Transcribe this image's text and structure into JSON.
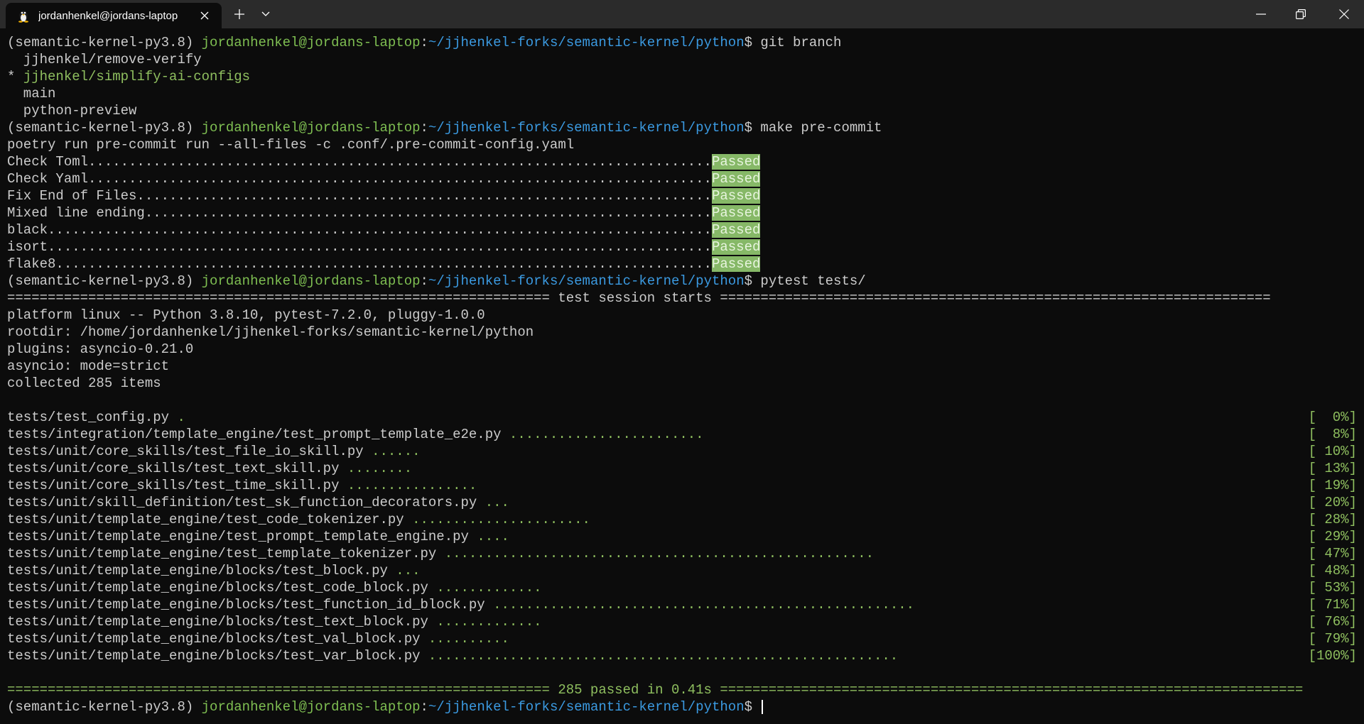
{
  "window": {
    "tab_title": "jordanhenkel@jordans-laptop",
    "tab_icon": "linux-penguin-icon",
    "new_tab_icon": "plus-icon",
    "dropdown_icon": "chevron-down-icon",
    "minimize_icon": "minimize-icon",
    "restore_icon": "restore-icon",
    "close_icon": "close-icon"
  },
  "colors": {
    "background": "#0c0c0c",
    "text": "#cccccc",
    "user": "#7fbf52",
    "path": "#3b9ae1",
    "passed_bg": "#86b867"
  },
  "prompt": {
    "env": "(semantic-kernel-py3.8) ",
    "user": "jordanhenkel@jordans-laptop",
    "sep": ":",
    "path": "~/jjhenkel-forks/semantic-kernel/python",
    "dollar": "$ "
  },
  "commands": {
    "git_branch": "git branch",
    "make_precommit": "make pre-commit",
    "pytest": "pytest tests/"
  },
  "branches": [
    {
      "text": "  jjhenkel/remove-verify",
      "current": false
    },
    {
      "text": "* ",
      "current_name": "jjhenkel/simplify-ai-configs",
      "current": true
    },
    {
      "text": "  main",
      "current": false
    },
    {
      "text": "  python-preview",
      "current": false
    }
  ],
  "precommit": {
    "run_line": "poetry run pre-commit run --all-files -c .conf/.pre-commit-config.yaml",
    "checks": [
      {
        "label": "Check Toml.............................................................................",
        "status": "Passed"
      },
      {
        "label": "Check Yaml.............................................................................",
        "status": "Passed"
      },
      {
        "label": "Fix End of Files.......................................................................",
        "status": "Passed"
      },
      {
        "label": "Mixed line ending......................................................................",
        "status": "Passed"
      },
      {
        "label": "black..................................................................................",
        "status": "Passed"
      },
      {
        "label": "isort..................................................................................",
        "status": "Passed"
      },
      {
        "label": "flake8.................................................................................",
        "status": "Passed"
      }
    ]
  },
  "pytest": {
    "header": "=================================================================== test session starts ====================================================================",
    "info": [
      "platform linux -- Python 3.8.10, pytest-7.2.0, pluggy-1.0.0",
      "rootdir: /home/jordanhenkel/jjhenkel-forks/semantic-kernel/python",
      "plugins: asyncio-0.21.0",
      "asyncio: mode=strict",
      "collected 285 items"
    ],
    "results": [
      {
        "file": "tests/test_config.py ",
        "dots": ".",
        "pct": "[  0%]"
      },
      {
        "file": "tests/integration/template_engine/test_prompt_template_e2e.py ",
        "dots": "........................",
        "pct": "[  8%]"
      },
      {
        "file": "tests/unit/core_skills/test_file_io_skill.py ",
        "dots": "......",
        "pct": "[ 10%]"
      },
      {
        "file": "tests/unit/core_skills/test_text_skill.py ",
        "dots": "........",
        "pct": "[ 13%]"
      },
      {
        "file": "tests/unit/core_skills/test_time_skill.py ",
        "dots": "................",
        "pct": "[ 19%]"
      },
      {
        "file": "tests/unit/skill_definition/test_sk_function_decorators.py ",
        "dots": "...",
        "pct": "[ 20%]"
      },
      {
        "file": "tests/unit/template_engine/test_code_tokenizer.py ",
        "dots": "......................",
        "pct": "[ 28%]"
      },
      {
        "file": "tests/unit/template_engine/test_prompt_template_engine.py ",
        "dots": "....",
        "pct": "[ 29%]"
      },
      {
        "file": "tests/unit/template_engine/test_template_tokenizer.py ",
        "dots": ".....................................................",
        "pct": "[ 47%]"
      },
      {
        "file": "tests/unit/template_engine/blocks/test_block.py ",
        "dots": "...",
        "pct": "[ 48%]"
      },
      {
        "file": "tests/unit/template_engine/blocks/test_code_block.py ",
        "dots": ".............",
        "pct": "[ 53%]"
      },
      {
        "file": "tests/unit/template_engine/blocks/test_function_id_block.py ",
        "dots": "....................................................",
        "pct": "[ 71%]"
      },
      {
        "file": "tests/unit/template_engine/blocks/test_text_block.py ",
        "dots": ".............",
        "pct": "[ 76%]"
      },
      {
        "file": "tests/unit/template_engine/blocks/test_val_block.py ",
        "dots": "..........",
        "pct": "[ 79%]"
      },
      {
        "file": "tests/unit/template_engine/blocks/test_var_block.py ",
        "dots": "..........................................................",
        "pct": "[100%]"
      }
    ],
    "footer_left": "=================================================================== ",
    "footer_summary": "285 passed in 0.41s",
    "footer_right": " ========================================================================"
  }
}
